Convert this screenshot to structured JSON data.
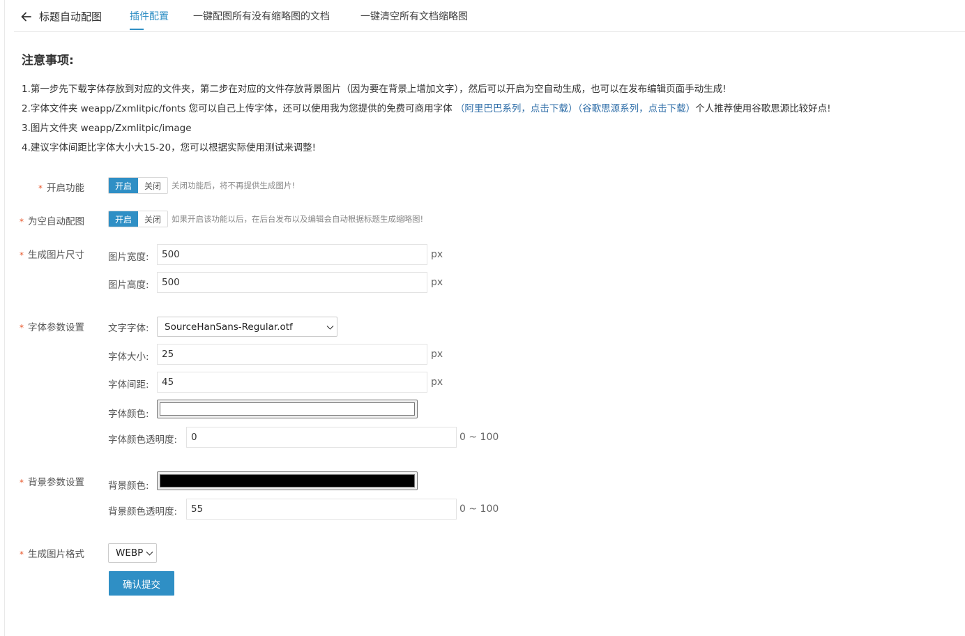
{
  "header": {
    "back_title": "标题自动配图",
    "tabs": [
      {
        "label": "插件配置",
        "active": true
      },
      {
        "label": "一键配图所有没有缩略图的文档",
        "active": false
      },
      {
        "label": "一键清空所有文档缩略图",
        "active": false
      }
    ]
  },
  "notice": {
    "title": "注意事项:",
    "line1": "1.第一步先下载字体存放到对应的文件夹，第二步在对应的文件存放背景图片（因为要在背景上增加文字），然后可以开启为空自动生成，也可以在发布编辑页面手动生成!",
    "line2_prefix": "2.字体文件夹 weapp/Zxmlitpic/fonts 您可以自己上传字体，还可以使用我为您提供的免费可商用字体 ",
    "link_alibaba": "（阿里巴巴系列，点击下载）",
    "link_google": "（谷歌思源系列，点击下载）",
    "line2_suffix": "个人推荐使用谷歌思源比较好点!",
    "line3": "3.图片文件夹 weapp/Zxmlitpic/image",
    "line4": "4.建议字体间距比字体大小大15-20，您可以根据实际使用测试来调整!"
  },
  "form": {
    "required_mark": "*",
    "enable": {
      "label": "开启功能",
      "on": "开启",
      "off": "关闭",
      "selected": "开启",
      "hint": "关闭功能后，将不再提供生成图片!"
    },
    "auto": {
      "label": "为空自动配图",
      "on": "开启",
      "off": "关闭",
      "selected": "开启",
      "hint": "如果开启该功能以后，在后台发布以及编辑会自动根据标题生成缩略图!"
    },
    "size": {
      "label": "生成图片尺寸",
      "width_label": "图片宽度:",
      "width_value": "500",
      "height_label": "图片高度:",
      "height_value": "500",
      "unit": "px"
    },
    "font": {
      "label": "字体参数设置",
      "family_label": "文字字体:",
      "family_value": "SourceHanSans-Regular.otf",
      "size_label": "字体大小:",
      "size_value": "25",
      "spacing_label": "字体间距:",
      "spacing_value": "45",
      "color_label": "字体颜色:",
      "color_value": "#ffffff",
      "opacity_label": "字体颜色透明度:",
      "opacity_value": "0",
      "unit": "px",
      "range": "0 ~ 100"
    },
    "background": {
      "label": "背景参数设置",
      "color_label": "背景颜色:",
      "color_value": "#000000",
      "opacity_label": "背景颜色透明度:",
      "opacity_value": "55",
      "range": "0 ~ 100"
    },
    "format": {
      "label": "生成图片格式",
      "value": "WEBP"
    },
    "submit": "确认提交"
  },
  "colors": {
    "accent": "#2f8fc5",
    "link": "#2f6ea8",
    "required": "#e8562a"
  }
}
